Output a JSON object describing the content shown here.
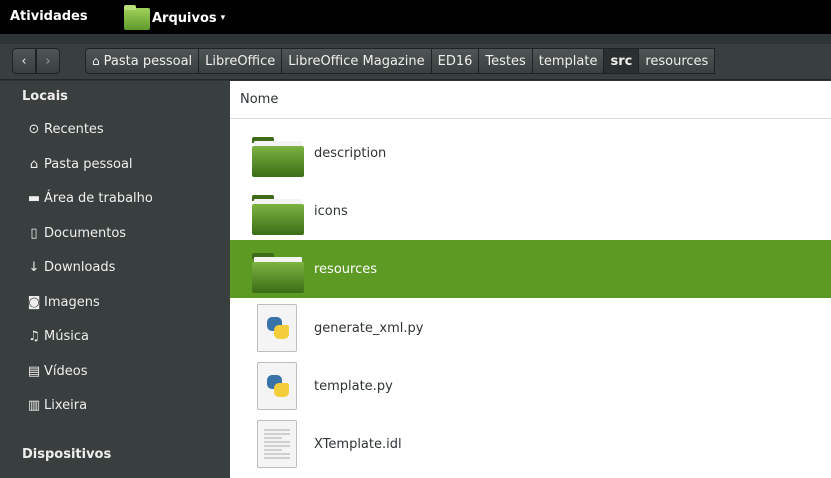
{
  "topbar": {
    "activities": "Atividades",
    "app_name": "Arquivos",
    "app_menu_arrow": "▾"
  },
  "toolbar": {
    "back_glyph": "‹",
    "forward_glyph": "›",
    "breadcrumbs": [
      "Pasta pessoal",
      "LibreOffice",
      "LibreOffice Magazine",
      "ED16",
      "Testes",
      "template",
      "src",
      "resources"
    ],
    "active_crumb": "src"
  },
  "sidebar": {
    "section_locais": "Locais",
    "items": [
      {
        "label": "Recentes",
        "icon": "clock-icon",
        "glyph": "⊙"
      },
      {
        "label": "Pasta pessoal",
        "icon": "home-icon",
        "glyph": "⌂"
      },
      {
        "label": "Área de trabalho",
        "icon": "desktop-folder-icon",
        "glyph": "▬"
      },
      {
        "label": "Documentos",
        "icon": "document-icon",
        "glyph": "▯"
      },
      {
        "label": "Downloads",
        "icon": "download-icon",
        "glyph": "↓"
      },
      {
        "label": "Imagens",
        "icon": "camera-icon",
        "glyph": "◙"
      },
      {
        "label": "Música",
        "icon": "music-icon",
        "glyph": "♫"
      },
      {
        "label": "Vídeos",
        "icon": "film-icon",
        "glyph": "▤"
      },
      {
        "label": "Lixeira",
        "icon": "trash-icon",
        "glyph": "▥"
      }
    ],
    "section_dispositivos": "Dispositivos"
  },
  "main": {
    "column_header": "Nome",
    "files": [
      {
        "name": "description",
        "type": "folder",
        "selected": false
      },
      {
        "name": "icons",
        "type": "folder",
        "selected": false
      },
      {
        "name": "resources",
        "type": "folder",
        "selected": true
      },
      {
        "name": "generate_xml.py",
        "type": "python",
        "selected": false
      },
      {
        "name": "template.py",
        "type": "python",
        "selected": false
      },
      {
        "name": "XTemplate.idl",
        "type": "text",
        "selected": false
      }
    ]
  },
  "colors": {
    "selection": "#5d9a24",
    "sidebar_bg": "#393f3f",
    "topbar_bg": "#000000"
  }
}
